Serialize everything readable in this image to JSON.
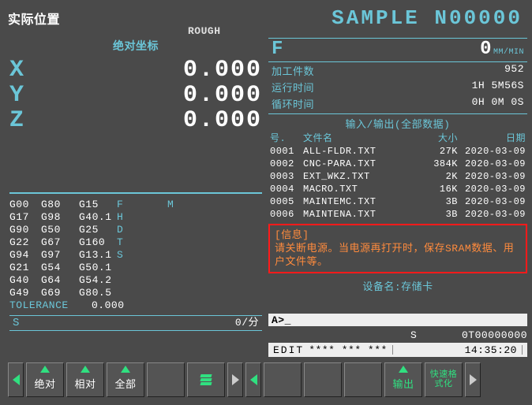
{
  "header": {
    "title": "实际位置",
    "mode": "ROUGH",
    "prog": "SAMPLE N00000"
  },
  "axis": {
    "head": "绝对坐标",
    "rows": [
      {
        "label": "X",
        "value": "0.000"
      },
      {
        "label": "Y",
        "value": "0.000"
      },
      {
        "label": "Z",
        "value": "0.000"
      }
    ]
  },
  "feed": {
    "label": "F",
    "value": "0",
    "unit": "MM/MIN"
  },
  "counters": [
    {
      "k": "加工件数",
      "v": "952"
    },
    {
      "k": "运行时间",
      "v": "1H 5M56S"
    },
    {
      "k": "循环时间",
      "v": "0H 0M 0S"
    }
  ],
  "filelist": {
    "title": "输入/输出(全部数据)",
    "head": {
      "no": "号.",
      "name": "文件名",
      "size": "大小",
      "date": "日期"
    },
    "rows": [
      {
        "no": "0001",
        "name": "ALL-FLDR.TXT",
        "size": "27K",
        "date": "2020-03-09"
      },
      {
        "no": "0002",
        "name": "CNC-PARA.TXT",
        "size": "384K",
        "date": "2020-03-09"
      },
      {
        "no": "0003",
        "name": "EXT_WKZ.TXT",
        "size": "2K",
        "date": "2020-03-09"
      },
      {
        "no": "0004",
        "name": "MACRO.TXT",
        "size": "16K",
        "date": "2020-03-09"
      },
      {
        "no": "0005",
        "name": "MAINTEMC.TXT",
        "size": "3B",
        "date": "2020-03-09"
      },
      {
        "no": "0006",
        "name": "MAINTENA.TXT",
        "size": "3B",
        "date": "2020-03-09"
      }
    ]
  },
  "message": {
    "head": "[信息]",
    "body": "请关断电源。当电源再打开时，保存SRAM数据、用户文件等。"
  },
  "device": {
    "label": "设备名:",
    "value": "存储卡"
  },
  "gcode": {
    "rows": [
      [
        "G00",
        "G80",
        "G15",
        "F",
        "",
        "M"
      ],
      [
        "G17",
        "G98",
        "G40.1",
        "H",
        "",
        ""
      ],
      [
        "G90",
        "G50",
        "G25",
        "D",
        "",
        ""
      ],
      [
        "G22",
        "G67",
        "G160",
        "T",
        "",
        ""
      ],
      [
        "G94",
        "G97",
        "G13.1",
        "S",
        "",
        ""
      ],
      [
        "G21",
        "G54",
        "G50.1",
        "",
        "",
        ""
      ],
      [
        "G40",
        "G64",
        "G54.2",
        "",
        "",
        ""
      ],
      [
        "G49",
        "G69",
        "G80.5",
        "",
        "",
        ""
      ]
    ],
    "tol_label": "TOLERANCE",
    "tol_value": "0.000"
  },
  "spindle": {
    "label": "S",
    "value": "0/分"
  },
  "status": {
    "prompt": "A>_",
    "s_label": "S",
    "s_val": "0T00000000",
    "edit": "EDIT",
    "stars": "**** *** ***",
    "time": "14:35:20"
  },
  "softkeys": {
    "k1": "绝对",
    "k2": "相对",
    "k3": "全部",
    "k4": "",
    "k5": "",
    "k6": "",
    "k7": "",
    "k8": "",
    "k9": "输出",
    "k10a": "快速格",
    "k10b": "式化"
  }
}
